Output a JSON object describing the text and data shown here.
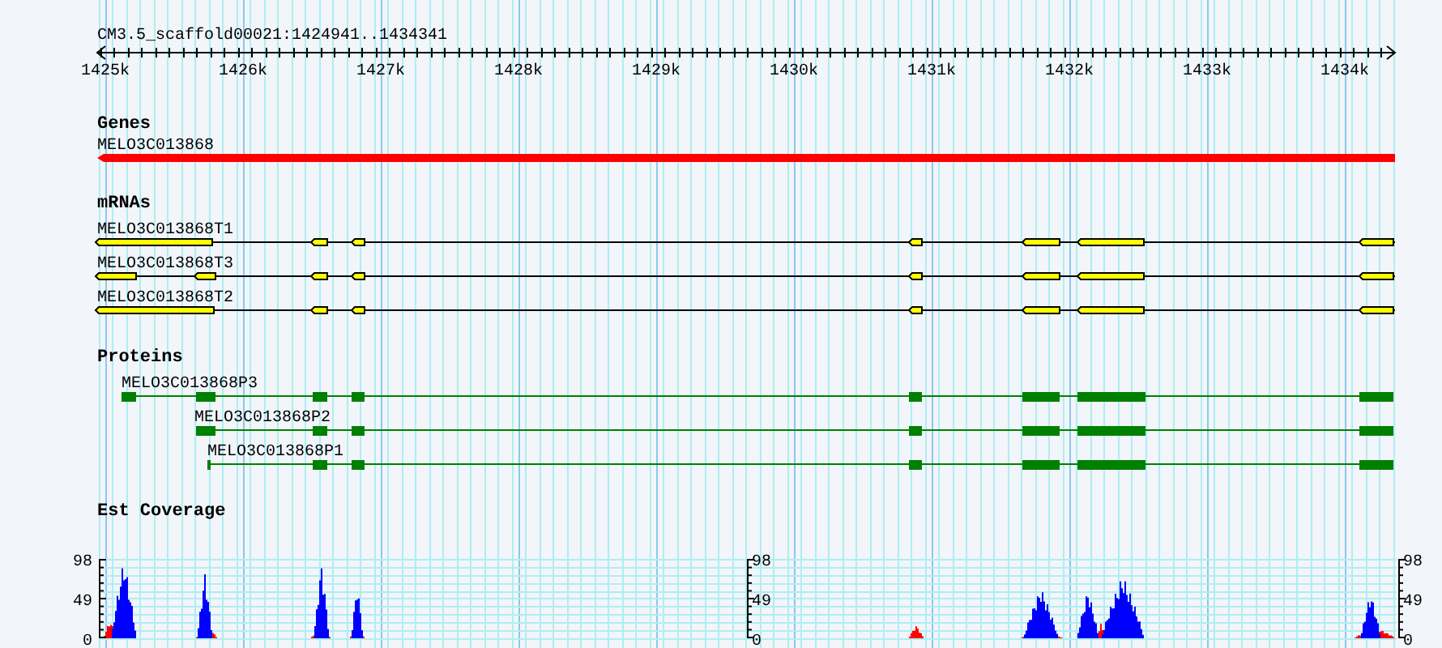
{
  "locus": {
    "title": "CM3.5_scaffold00021:1424941..1434341"
  },
  "ruler": {
    "ticks": [
      "1425k",
      "1426k",
      "1427k",
      "1428k",
      "1429k",
      "1430k",
      "1431k",
      "1432k",
      "1433k",
      "1434k"
    ]
  },
  "tracks": [
    {
      "kind": "gene",
      "title": "Genes",
      "features": [
        {
          "label": "MELO3C013868"
        }
      ]
    },
    {
      "kind": "mrna",
      "title": "mRNAs",
      "features": [
        {
          "label": "MELO3C013868T1"
        },
        {
          "label": "MELO3C013868T3"
        },
        {
          "label": "MELO3C013868T2"
        }
      ]
    },
    {
      "kind": "protein",
      "title": "Proteins",
      "features": [
        {
          "label": "MELO3C013868P3"
        },
        {
          "label": "MELO3C013868P2"
        },
        {
          "label": "MELO3C013868P1"
        }
      ]
    },
    {
      "kind": "coverage",
      "title": "Est Coverage",
      "axes": [
        {
          "ticks": [
            "98",
            "49",
            "0"
          ]
        },
        {
          "ticks": [
            "98",
            "49",
            "0"
          ]
        },
        {
          "ticks": [
            "98",
            "49",
            "0"
          ]
        }
      ]
    }
  ]
}
